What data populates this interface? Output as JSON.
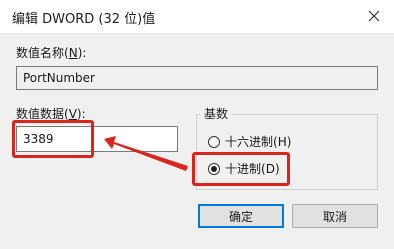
{
  "window": {
    "title": "编辑 DWORD (32 位)值"
  },
  "value_name": {
    "label": "数值名称",
    "mnemonic": "N",
    "value": "PortNumber"
  },
  "value_data": {
    "label": "数值数据",
    "mnemonic": "V",
    "value": "3389"
  },
  "base": {
    "title": "基数",
    "options": [
      {
        "label": "十六进制",
        "mnemonic": "H",
        "selected": false
      },
      {
        "label": "十进制",
        "mnemonic": "D",
        "selected": true
      }
    ]
  },
  "buttons": {
    "ok": "确定",
    "cancel": "取消"
  },
  "colors": {
    "highlight": "#d9251c",
    "focus": "#0078d7"
  },
  "icons": {
    "close": "close-icon"
  }
}
